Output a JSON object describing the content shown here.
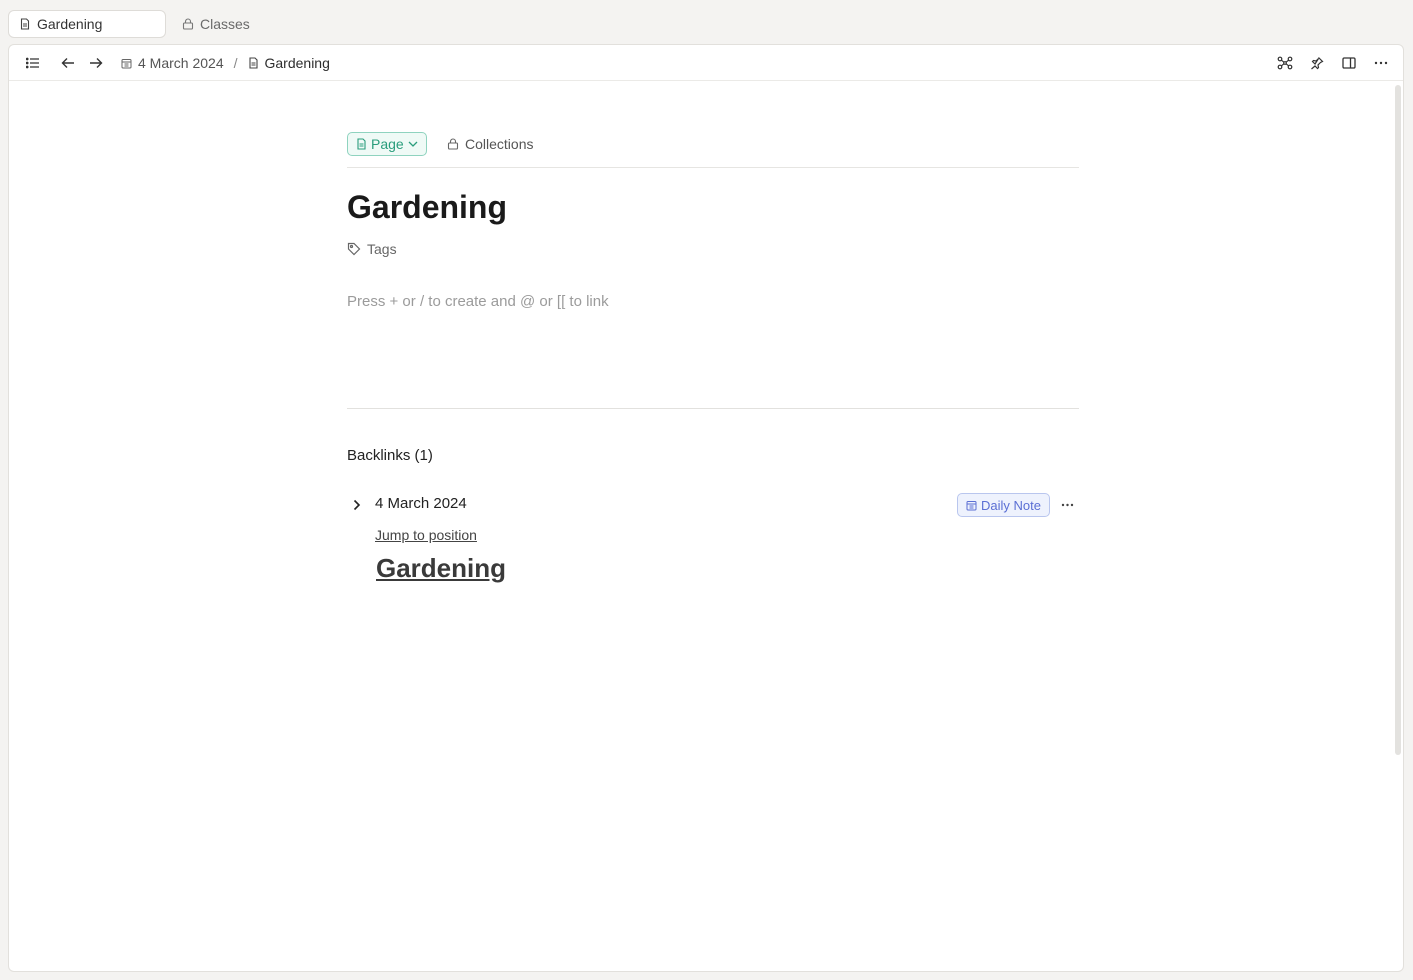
{
  "tabs": [
    {
      "label": "Gardening",
      "icon": "page-icon"
    },
    {
      "label": "Classes",
      "icon": "lock-icon"
    }
  ],
  "breadcrumb": {
    "parent": "4 March 2024",
    "separator": "/",
    "current": "Gardening"
  },
  "page": {
    "type_label": "Page",
    "collections_label": "Collections",
    "title": "Gardening",
    "tags_label": "Tags",
    "editor_placeholder": "Press + or / to create and @ or [[ to link"
  },
  "backlinks": {
    "title": "Backlinks (1)",
    "items": [
      {
        "date": "4 March 2024",
        "badge": "Daily Note",
        "jump_label": "Jump to position",
        "link_text": "Gardening"
      }
    ]
  },
  "colors": {
    "page_badge": "#2a9d7c",
    "daily_note_badge": "#5b6fd4"
  }
}
